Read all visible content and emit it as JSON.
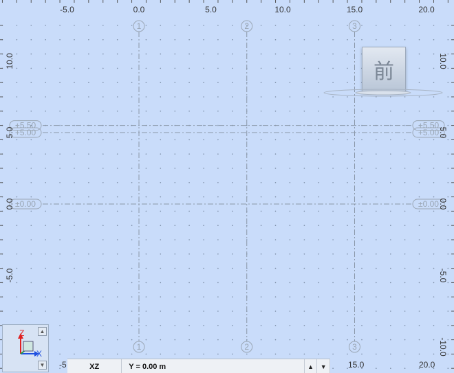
{
  "ruler": {
    "top_x_labels": [
      "-5.0",
      "0.0",
      "5.0",
      "10.0",
      "15.0",
      "20.0"
    ],
    "left_z_labels": [
      "10.0",
      "5.0",
      "0.0",
      "-5.0",
      "-10.0"
    ],
    "right_z_labels": [
      "10.0",
      "5.0",
      "0.0",
      "-5.0",
      "-10.0"
    ],
    "bottom_x_labels": [
      "-5",
      "15.0",
      "20.0"
    ]
  },
  "gridlines": {
    "axis_labels": [
      "1",
      "2",
      "3"
    ]
  },
  "levels": [
    {
      "label": "+5.50"
    },
    {
      "label": "+5.00"
    },
    {
      "label": "±0.00"
    }
  ],
  "viewcube": {
    "face_label": "前"
  },
  "axis_widget": {
    "z_label": "Z",
    "x_label": "X",
    "up_button": "▲",
    "down_button": "▼"
  },
  "statusbar": {
    "plane": "XZ",
    "y_value": "Y = 0.00 m",
    "spin_up": "▲",
    "spin_down": "▼"
  },
  "colors": {
    "background": "#c9dcfa",
    "z_axis": "#e02020",
    "x_axis": "#2050e0",
    "y_axis": "#20a040"
  }
}
